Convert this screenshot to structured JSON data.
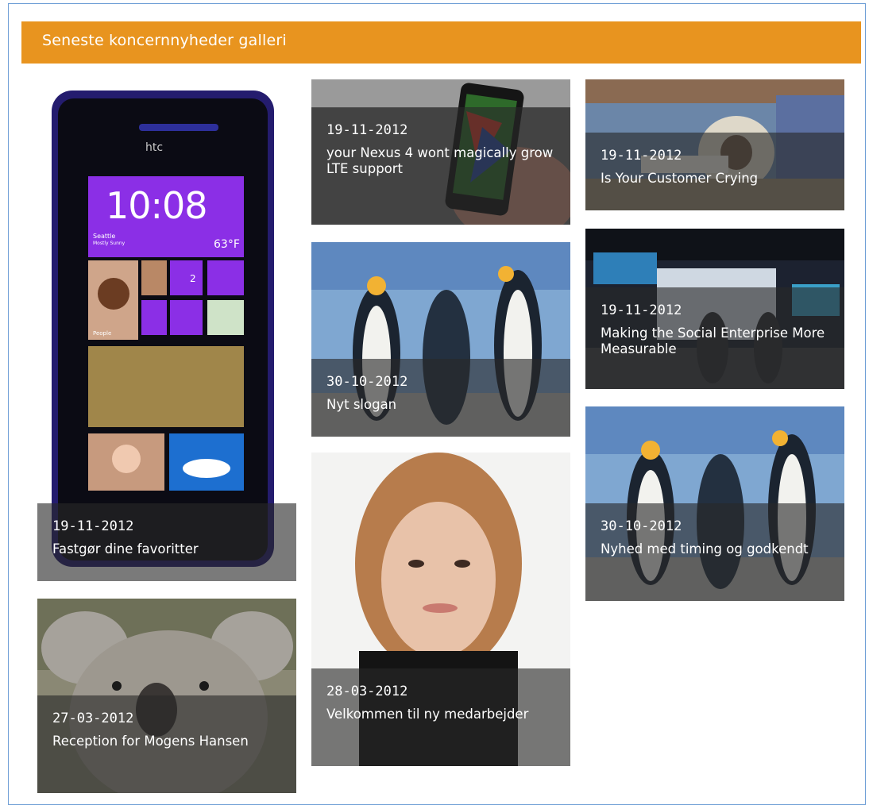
{
  "gallery": {
    "title": "Seneste koncernnyheder galleri",
    "items": [
      {
        "date": "19-11-2012",
        "title": "Fastgør dine favoritter",
        "image": "htc-phone-image"
      },
      {
        "date": "27-03-2012",
        "title": "Reception for Mogens Hansen",
        "image": "koala-image"
      },
      {
        "date": "19-11-2012",
        "title": "your Nexus 4 wont magically grow LTE support",
        "image": "phone-in-hand-image"
      },
      {
        "date": "30-10-2012",
        "title": "Nyt slogan",
        "image": "penguins-image"
      },
      {
        "date": "28-03-2012",
        "title": "Velkommen til ny medarbejder",
        "image": "woman-portrait-image"
      },
      {
        "date": "19-11-2012",
        "title": "Is Your Customer Crying",
        "image": "medical-scanner-image"
      },
      {
        "date": "19-11-2012",
        "title": "Making the Social Enterprise More Measurable",
        "image": "expo-hall-image"
      },
      {
        "date": "30-10-2012",
        "title": "Nyhed med timing og godkendt",
        "image": "penguins-image"
      }
    ],
    "phone_screen": {
      "brand": "htc",
      "time": "10:08",
      "city": "Seattle",
      "weather": "Mostly Sunny",
      "temp": "63°F",
      "msg_count": "2",
      "people_label": "People"
    }
  },
  "colors": {
    "header": "#e8941f",
    "frame_border": "#6f9fd6",
    "caption_bg": "#282828",
    "phone_tile": "#8a2be2"
  }
}
